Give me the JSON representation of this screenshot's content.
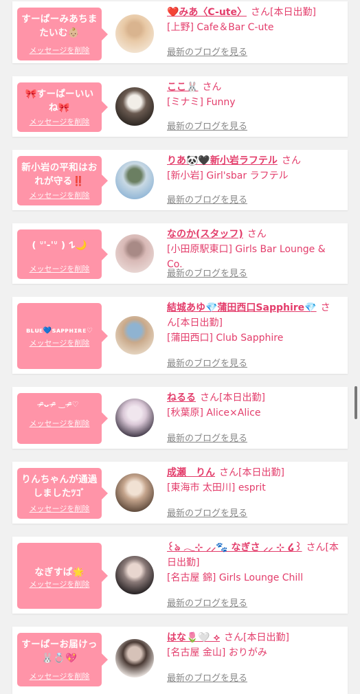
{
  "delete_label": "メッセージを削除",
  "blog_label": "最新のブログを見る",
  "cards": [
    {
      "bubble": "すーぱーみあちまたいむ👶🏼",
      "name": "❤️みあ〈C-ute〉",
      "san": "さん",
      "status": "[本日出勤]",
      "shop": "[上野] Cafe＆Bar C-ute",
      "avatar_colors": [
        "#f3e4d2",
        "#e8c9a6",
        "#d9b48f"
      ]
    },
    {
      "bubble": "🎀すーぱーいいね🎀",
      "name": "ここ🐰",
      "san": "さん",
      "status": "",
      "shop": "[ミナミ] Funny",
      "avatar_colors": [
        "#2a2420",
        "#6a5a50",
        "#f2eee8"
      ]
    },
    {
      "bubble": "新小岩の平和はおれが守る‼️",
      "name": "りあ🐼🖤新小岩ラフテル",
      "san": "さん",
      "status": "",
      "shop": "[新小岩] Girl'sbar ラフテル",
      "avatar_colors": [
        "#8fb5d6",
        "#c9d9e4",
        "#6b7f62"
      ]
    },
    {
      "bubble": "( ᐡ'-'ᐡ ) 𐰁🌙",
      "name": "なのか(スタッフ)",
      "san": "さん",
      "status": "",
      "shop": "[小田原駅東口] Girls Bar Lounge & Co.",
      "avatar_colors": [
        "#e9d7d4",
        "#d8b9b6",
        "#a88a86"
      ]
    },
    {
      "bubble": "ʙʟᴜᴇ💙ꜱᴀᴘᴘʜɪʀᴇ♡",
      "name": "結城あゆ💎蒲田西口Sapphire💎",
      "san": "さ",
      "status": "ん[本日出勤]",
      "shop": "[蒲田西口] Club Sapphire",
      "avatar_colors": [
        "#e6d6c2",
        "#c9a98a",
        "#8fb3d1"
      ]
    },
    {
      "bubble": "ᵔ̴̶̷ᴗ ᵔ̴̶̷ ‿ ᵔ̴̶̷♡",
      "name": "ねるる",
      "san": "さん",
      "status": "[本日出勤]",
      "shop": "[秋葉原] Alice×Alice",
      "avatar_colors": [
        "#3b3342",
        "#d9c7d6",
        "#f0e6ee"
      ]
    },
    {
      "bubble": "りんちゃんが通過しましたﾂｺﾞ",
      "name": "成瀬　りん",
      "san": "さん",
      "status": "[本日出勤]",
      "shop": "[東海市 太田川] esprit",
      "avatar_colors": [
        "#5a4638",
        "#c4a48c",
        "#f1e1d3"
      ]
    },
    {
      "bubble": "なぎすぱ🌟",
      "name": "꒰ঌ 𓂃⊹ ⸝⸝🐾 なぎさ ⸝⸝ ⊹ ໒꒱",
      "san": "さん",
      "status": "[本日出勤]",
      "shop": "[名古屋 錦] Girls Lounge Chill",
      "avatar_colors": [
        "#201c1e",
        "#8a7a78",
        "#e8d6cf"
      ]
    },
    {
      "bubble": "すーぱーお届けっ🐰💍💖",
      "name": "はな🌷🤍 ⟡",
      "san": "さん",
      "status": "[本日出勤]",
      "shop": "[名古屋 金山] おりがみ",
      "avatar_colors": [
        "#f6f0ec",
        "#4a3a34",
        "#d6c2b8"
      ]
    }
  ]
}
